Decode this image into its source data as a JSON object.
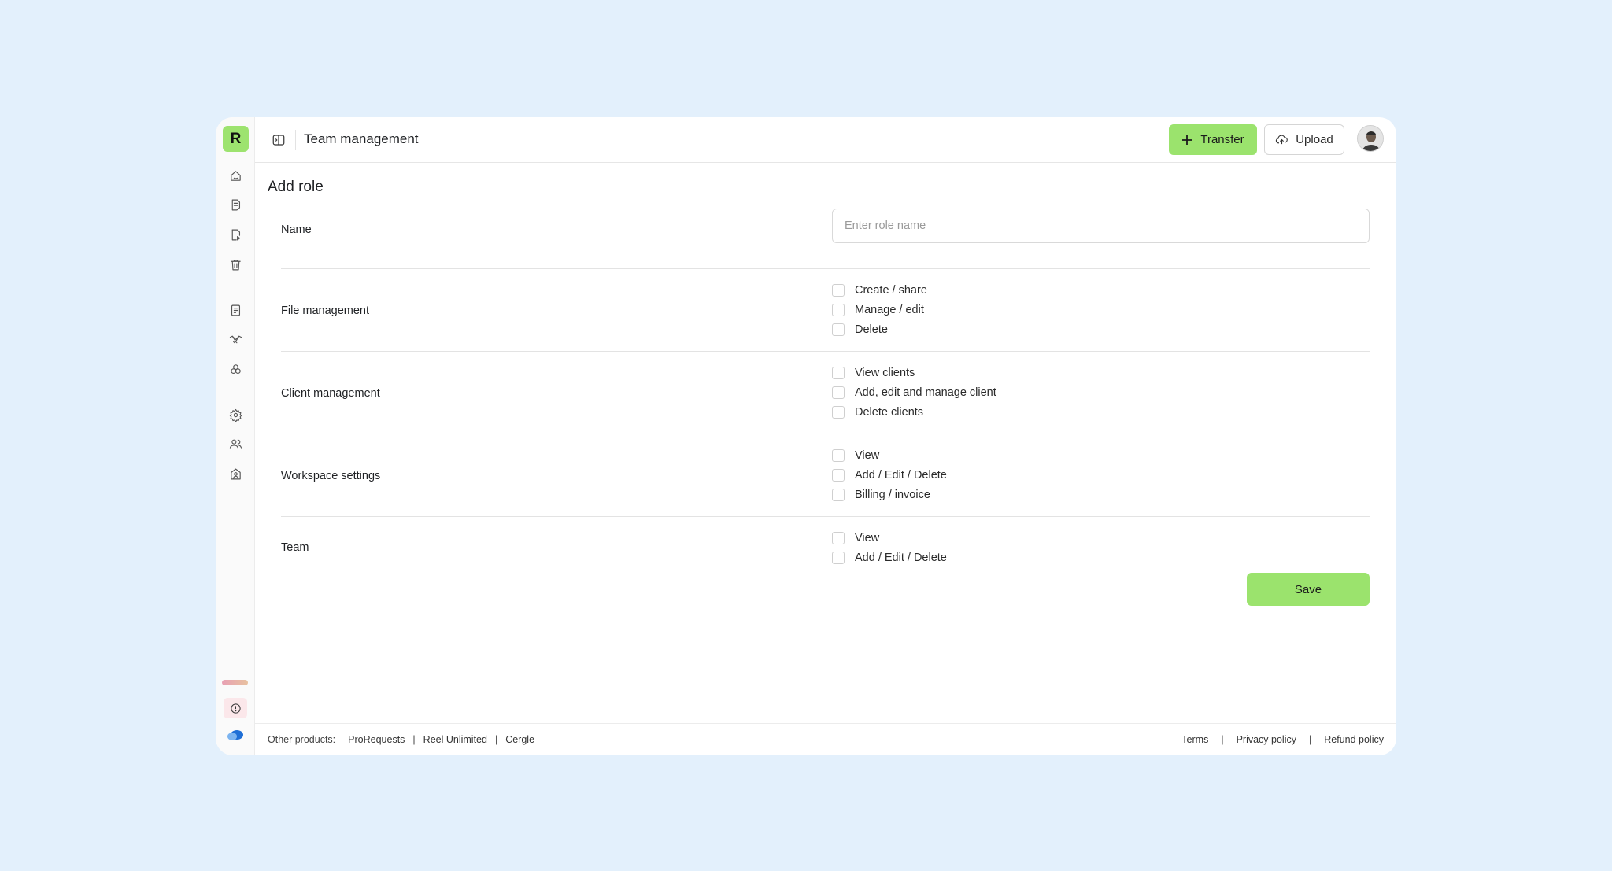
{
  "app": {
    "logo_letter": "R",
    "brand_color": "#9be36d"
  },
  "sidebar": {
    "icons": [
      "home-icon",
      "documents-icon",
      "shared-icon",
      "trash-icon",
      "invoice-icon",
      "handshake-icon",
      "integrations-icon",
      "settings-icon",
      "team-icon",
      "workspace-icon"
    ],
    "bottom": [
      "storage-bar",
      "alert-icon",
      "cloud-icon"
    ]
  },
  "header": {
    "title": "Team management",
    "transfer_label": "Transfer",
    "upload_label": "Upload"
  },
  "page": {
    "section_title": "Add role",
    "name": {
      "label": "Name",
      "placeholder": "Enter role name",
      "value": ""
    },
    "groups": [
      {
        "label": "File management",
        "options": [
          "Create / share",
          "Manage / edit",
          "Delete"
        ]
      },
      {
        "label": "Client management",
        "options": [
          "View clients",
          "Add, edit and manage client",
          "Delete clients"
        ]
      },
      {
        "label": "Workspace settings",
        "options": [
          "View",
          "Add / Edit / Delete",
          "Billing / invoice"
        ]
      },
      {
        "label": "Team",
        "options": [
          "View",
          "Add / Edit / Delete"
        ]
      }
    ],
    "save_label": "Save"
  },
  "footer": {
    "other_products_label": "Other products:",
    "products": [
      "ProRequests",
      "Reel Unlimited",
      "Cergle"
    ],
    "links": [
      "Terms",
      "Privacy policy",
      "Refund policy"
    ]
  }
}
